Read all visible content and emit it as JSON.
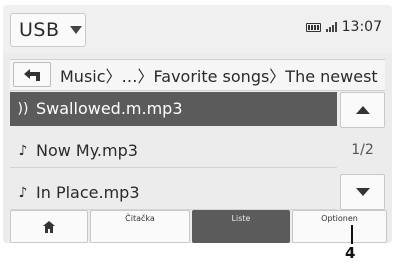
{
  "header": {
    "source_label": "USB",
    "source_caret_icon": "caret-down-icon",
    "clock": "13:07"
  },
  "path": {
    "back_icon": "back-arrow-icon",
    "text": "Music〉…〉Favorite songs〉The newest"
  },
  "tracks": [
    {
      "label": "Swallowed.m.mp3",
      "icon": "now-playing-icon",
      "mark": "))",
      "active": true
    },
    {
      "label": "Now My.mp3",
      "icon": "music-note-icon",
      "mark": "♪",
      "active": false
    },
    {
      "label": "In Place.mp3",
      "icon": "music-note-icon",
      "mark": "♪",
      "active": false
    }
  ],
  "scroll": {
    "page_indicator": "1/2"
  },
  "bottom": {
    "home_icon": "home-icon",
    "reader_label": "Čitačka",
    "list_label": "Liste",
    "options_label": "Optionen"
  },
  "callout": {
    "number": "4"
  }
}
